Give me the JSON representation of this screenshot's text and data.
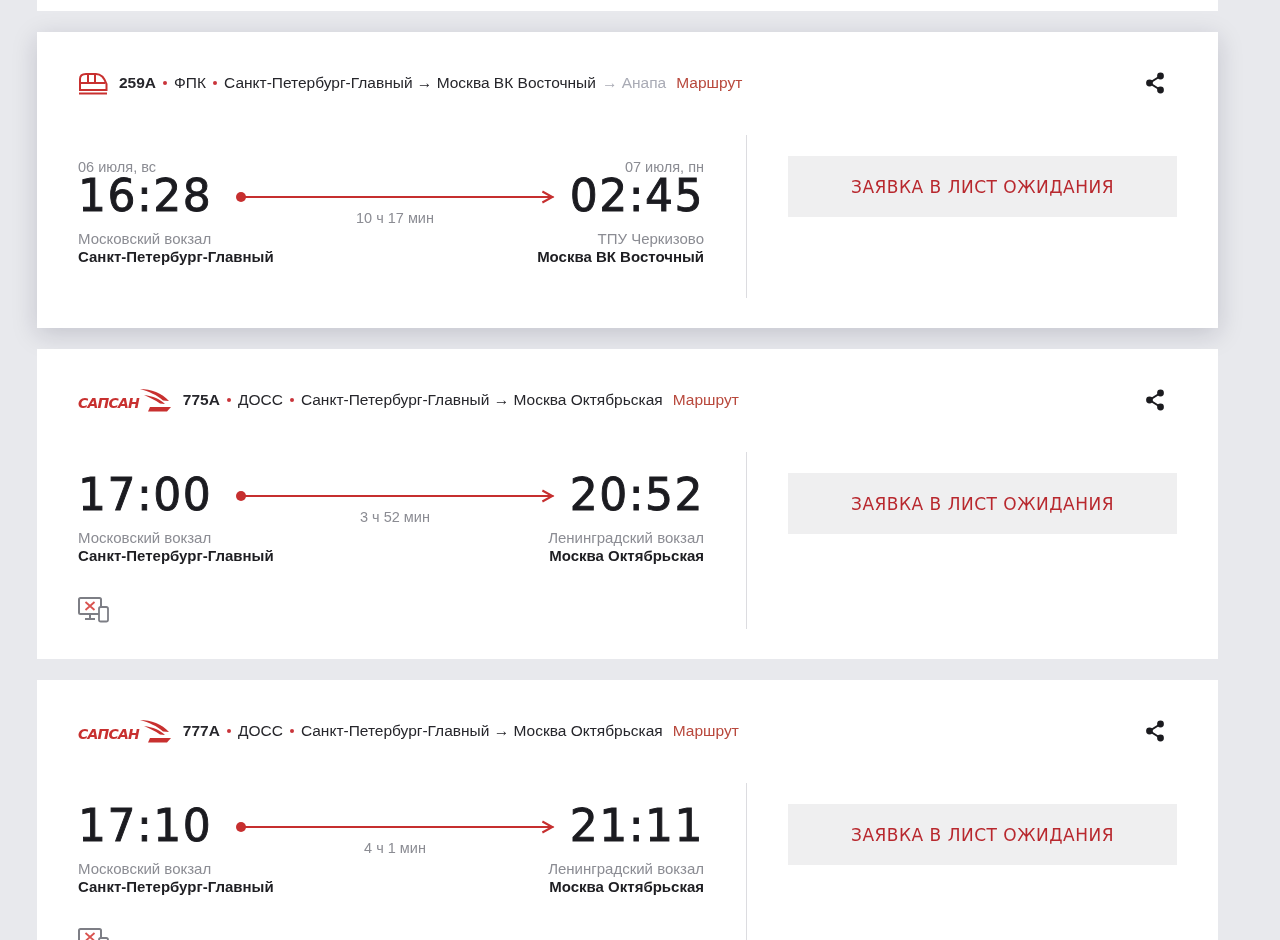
{
  "trains": [
    {
      "elevated": true,
      "logo": {
        "kind": "fpk"
      },
      "number": "259А",
      "carrier": "ФПК",
      "route": "Санкт-Петербург-Главный → Москва ВК Восточный",
      "route_continuation": "→ Анапа",
      "route_link": "Маршрут",
      "departure": {
        "date": "06 июля, вс",
        "time": "16:28",
        "station": "Московский вокзал",
        "name": "Санкт-Петербург-Главный"
      },
      "duration": "10 ч 17 мин",
      "arrival": {
        "date": "07 июля, пн",
        "time": "02:45",
        "station": "ТПУ Черкизово",
        "name": "Москва ВК Восточный"
      },
      "action": "ЗАЯВКА В ЛИСТ ОЖИДАНИЯ"
    },
    {
      "elevated": false,
      "logo": {
        "kind": "sapsan",
        "text": "САПСАН"
      },
      "number": "775А",
      "carrier": "ДОСС",
      "route": "Санкт-Петербург-Главный → Москва Октябрьская",
      "route_link": "Маршрут",
      "departure": {
        "time": "17:00",
        "station": "Московский вокзал",
        "name": "Санкт-Петербург-Главный"
      },
      "duration": "3 ч 52 мин",
      "arrival": {
        "time": "20:52",
        "station": "Ленинградский вокзал",
        "name": "Москва Октябрьская"
      },
      "action": "ЗАЯВКА В ЛИСТ ОЖИДАНИЯ",
      "service_icons": [
        {
          "kind": "no-screen"
        }
      ]
    },
    {
      "elevated": false,
      "logo": {
        "kind": "sapsan",
        "text": "САПСАН"
      },
      "number": "777А",
      "carrier": "ДОСС",
      "route": "Санкт-Петербург-Главный → Москва Октябрьская",
      "route_link": "Маршрут",
      "departure": {
        "time": "17:10",
        "station": "Московский вокзал",
        "name": "Санкт-Петербург-Главный"
      },
      "duration": "4 ч 1 мин",
      "arrival": {
        "time": "21:11",
        "station": "Ленинградский вокзал",
        "name": "Москва Октябрьская"
      },
      "action": "ЗАЯВКА В ЛИСТ ОЖИДАНИЯ",
      "service_icons": [
        {
          "kind": "no-screen"
        }
      ]
    }
  ]
}
